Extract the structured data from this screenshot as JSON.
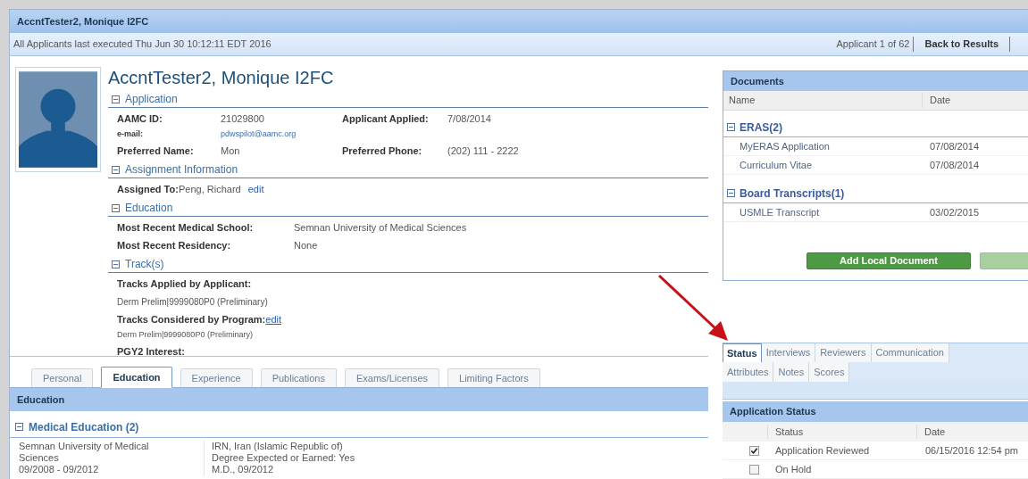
{
  "window": {
    "title": "AccntTester2, Monique I2FC"
  },
  "info_bar": {
    "text": "All Applicants last executed Thu Jun 30 10:12:11 EDT 2016",
    "position": "Applicant 1 of 62",
    "back_link": "Back to Results"
  },
  "profile": {
    "name": "AccntTester2, Monique I2FC",
    "sections": [
      {
        "title": "Application",
        "expanded": true,
        "rows": [
          {
            "kind": "pair",
            "label": "AAMC ID:",
            "value": "21029800",
            "label2": "Applicant Applied:",
            "value2": "7/08/2014"
          },
          {
            "kind": "small",
            "label": "e-mail:",
            "value": "pdwspilot@aamc.org"
          },
          {
            "kind": "pair",
            "label": "Preferred Name:",
            "value": "Mon",
            "label2": "Preferred Phone:",
            "value2": "(202) 111 - 2222"
          }
        ]
      },
      {
        "title": "Assignment Information",
        "expanded": true,
        "rows": [
          {
            "kind": "link",
            "label": "Assigned To:",
            "value": "Peng, Richard",
            "link": "edit"
          }
        ]
      },
      {
        "title": "Education",
        "expanded": true,
        "rows": [
          {
            "kind": "wide",
            "label": "Most Recent Medical School:",
            "value": "Semnan University of Medical Sciences"
          },
          {
            "kind": "wide",
            "label": "Most Recent Residency:",
            "value": "None"
          }
        ]
      },
      {
        "title": "Track(s)",
        "expanded": true,
        "rows": [
          {
            "kind": "heading",
            "label": "Tracks Applied by Applicant:"
          },
          {
            "kind": "note",
            "value": "Derm Prelim|9999080P0 (Preliminary)"
          },
          {
            "kind": "headlink",
            "label": "Tracks Considered by Program:",
            "link": "edit"
          },
          {
            "kind": "smallnote",
            "value": "Derm Prelim|9999080P0 (Preliminary)"
          },
          {
            "kind": "heading",
            "label": "PGY2 Interest:"
          }
        ]
      }
    ]
  },
  "detail_tabs": [
    {
      "label": "Personal",
      "selected": false
    },
    {
      "label": "Education",
      "selected": true
    },
    {
      "label": "Experience",
      "selected": false
    },
    {
      "label": "Publications",
      "selected": false
    },
    {
      "label": "Exams/Licenses",
      "selected": false
    },
    {
      "label": "Limiting Factors",
      "selected": false
    }
  ],
  "education_panel": {
    "title": "Education",
    "group": {
      "title": "Medical Education (2)",
      "expanded": true
    },
    "rows": [
      {
        "school": "Semnan University of Medical Sciences",
        "dates": "09/2008 - 09/2012",
        "details": [
          "IRN, Iran (Islamic Republic of)",
          "Degree Expected or Earned: Yes",
          "M.D., 09/2012"
        ]
      }
    ]
  },
  "documents": {
    "title": "Documents",
    "columns": [
      "Name",
      "Date"
    ],
    "groups": [
      {
        "title": "ERAS(2)",
        "expanded": true,
        "rows": [
          {
            "name": "MyERAS Application",
            "date": "07/08/2014"
          },
          {
            "name": "Curriculum Vitae",
            "date": "07/08/2014"
          }
        ]
      },
      {
        "title": "Board Transcripts(1)",
        "expanded": true,
        "rows": [
          {
            "name": "USMLE Transcript",
            "date": "03/02/2015"
          }
        ]
      }
    ],
    "buttons": [
      {
        "label": "Add Local Document",
        "disabled": false
      },
      {
        "disabled": true
      }
    ]
  },
  "status_tabs": [
    [
      {
        "label": "Status",
        "selected": true
      },
      {
        "label": "Interviews",
        "selected": false
      },
      {
        "label": "Reviewers",
        "selected": false
      },
      {
        "label": "Communication",
        "selected": false
      }
    ],
    [
      {
        "label": "Attributes",
        "selected": false
      },
      {
        "label": "Notes",
        "selected": false
      },
      {
        "label": "Scores",
        "selected": false
      }
    ]
  ],
  "application_status": {
    "title": "Application Status",
    "columns": [
      "Status",
      "Date"
    ],
    "rows": [
      {
        "status": "Application Reviewed",
        "date": "06/15/2016 12:54 pm",
        "checked": true
      },
      {
        "status": "On Hold",
        "checked": false
      }
    ]
  }
}
